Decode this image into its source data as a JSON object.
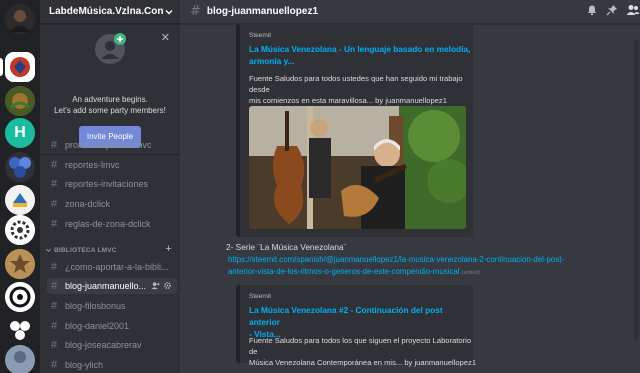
{
  "server_rail": {
    "servers": [
      {
        "name": "user-avatar",
        "color": "#3a3a3a"
      },
      {
        "name": "server-red-logo",
        "color": "#c0392b"
      },
      {
        "name": "server-crest",
        "color": "#5a6b2d"
      },
      {
        "name": "server-h",
        "letter": "H",
        "color": "#1abc9c"
      },
      {
        "name": "server-cluster",
        "color": "#3b66c4"
      },
      {
        "name": "server-pirate",
        "color": "#e8e8e8"
      },
      {
        "name": "server-gears",
        "color": "#ffffff"
      },
      {
        "name": "server-emblem",
        "color": "#c9a96e"
      },
      {
        "name": "server-badge",
        "color": "#ffffff"
      },
      {
        "name": "server-balls",
        "color": "#202225"
      },
      {
        "name": "server-avatar-bottom",
        "color": "#7a8aa0"
      }
    ]
  },
  "sidebar": {
    "guild_name": "LabdeMúsica.Vzlna.Cont...",
    "popup": {
      "line1": "An adventure begins.",
      "line2": "Let's add some party members!",
      "button": "Invite People",
      "close": "✕"
    },
    "channels_top": [
      "promo-etiquetas-lmvc",
      "reportes-lmvc",
      "reportes-invitaciones",
      "zona-dclick",
      "reglas-de-zona-dclick"
    ],
    "category": "BIBLIOTECA LMVC",
    "category_plus": "+",
    "channels_bottom": [
      "¿como-aportar-a-la-bibli...",
      "blog-juanmanuello...",
      "blog-filosbonus",
      "blog-daniel2001",
      "blog-joseacabrerav",
      "blog-ylich"
    ]
  },
  "main": {
    "channel_title": "blog-juanmanuellopez1",
    "embed1": {
      "provider": "Steemit",
      "title_line1": "La Música Venezolana - Un lenguaje basado en melodía,",
      "title_line2": "armonía y...",
      "desc_line1": "Fuente Saludos para todos ustedes que han seguido mi trabajo desde",
      "desc_line2": "mis comienzos en esta maravillosa... by juanmanuellopez1"
    },
    "message": {
      "text": "2- Serie ¨La Música Venezolana¨",
      "link_line1": "https://steemit.com/spanish/@juanmanuellopez1/la-musica-venezolana-2-continuacion-del-post-",
      "link_line2": "anterior-vista-de-los-ritmos-o-generos-de-este-compendio-musical",
      "edited": "(edited)"
    },
    "embed2": {
      "provider": "Steemit",
      "title_line1": "La Música Venezolana #2 - Continuación del post anterior",
      "title_line2": "- Vista...",
      "desc_line1": "Fuente Saludos para todos los que siguen el proyecto Laboratorio de",
      "desc_line2": "Música Venezolana Contemporánea en mis... by juanmanuellopez1"
    }
  }
}
